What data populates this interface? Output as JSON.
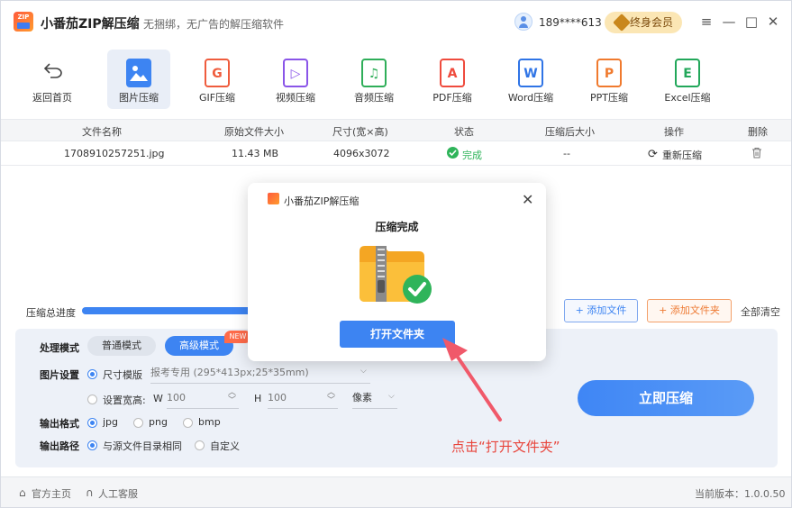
{
  "app": {
    "logo_text": "ZIP",
    "title": "小番茄ZIP解压缩",
    "separator": "|",
    "slogan": "无捆绑，无广告的解压缩软件",
    "user_phone": "189****613",
    "vip_label": "终身会员"
  },
  "window_controls": {
    "menu": "≡",
    "minimize": "—",
    "maximize": "□",
    "close": "✕"
  },
  "toolbar": {
    "back_label": "返回首页",
    "tools": [
      {
        "label": "图片压缩",
        "glyph": "",
        "color": "#3d84f2"
      },
      {
        "label": "GIF压缩",
        "glyph": "G",
        "color": "#ef5c3d"
      },
      {
        "label": "视频压缩",
        "glyph": "▷",
        "color": "#8a55e8"
      },
      {
        "label": "音频压缩",
        "glyph": "♫",
        "color": "#2fae59"
      },
      {
        "label": "PDF压缩",
        "glyph": "A",
        "color": "#ef4b3d"
      },
      {
        "label": "Word压缩",
        "glyph": "W",
        "color": "#2f74e6"
      },
      {
        "label": "PPT压缩",
        "glyph": "P",
        "color": "#f07a2e"
      },
      {
        "label": "Excel压缩",
        "glyph": "E",
        "color": "#22a75a"
      }
    ]
  },
  "table": {
    "headers": [
      "文件名称",
      "原始文件大小",
      "尺寸(宽×高)",
      "状态",
      "压缩后大小",
      "操作",
      "删除"
    ],
    "rows": [
      {
        "name": "1708910257251.jpg",
        "size": "11.43 MB",
        "dims": "4096x3072",
        "status": "完成",
        "compressed": "--",
        "action": "重新压缩"
      }
    ]
  },
  "progress": {
    "label": "压缩总进度",
    "value": 1.0
  },
  "actions": {
    "add_file": "添加文件",
    "add_folder": "添加文件夹",
    "clear_all": "全部清空"
  },
  "settings": {
    "mode_label": "处理模式",
    "mode_normal": "普通模式",
    "mode_advanced": "高级模式",
    "new_badge": "NEW",
    "image_label": "图片设置",
    "size_template": "尺寸模版",
    "template_value": "报考专用 (295*413px;25*35mm)",
    "custom_size": "设置宽高:",
    "w_label": "W",
    "w_value": "100",
    "h_label": "H",
    "h_value": "100",
    "unit": "像素",
    "format_label": "输出格式",
    "formats": [
      "jpg",
      "png",
      "bmp"
    ],
    "path_label": "输出路径",
    "path_same": "与源文件目录相同",
    "path_custom": "自定义",
    "compress_button": "立即压缩"
  },
  "footer": {
    "home": "官方主页",
    "support": "人工客服",
    "version": "当前版本：1.0.0.50"
  },
  "dialog": {
    "title": "小番茄ZIP解压缩",
    "message": "压缩完成",
    "open_button": "打开文件夹"
  },
  "annotation": {
    "tip": "点击“打开文件夹”",
    "color": "#e8453c"
  }
}
